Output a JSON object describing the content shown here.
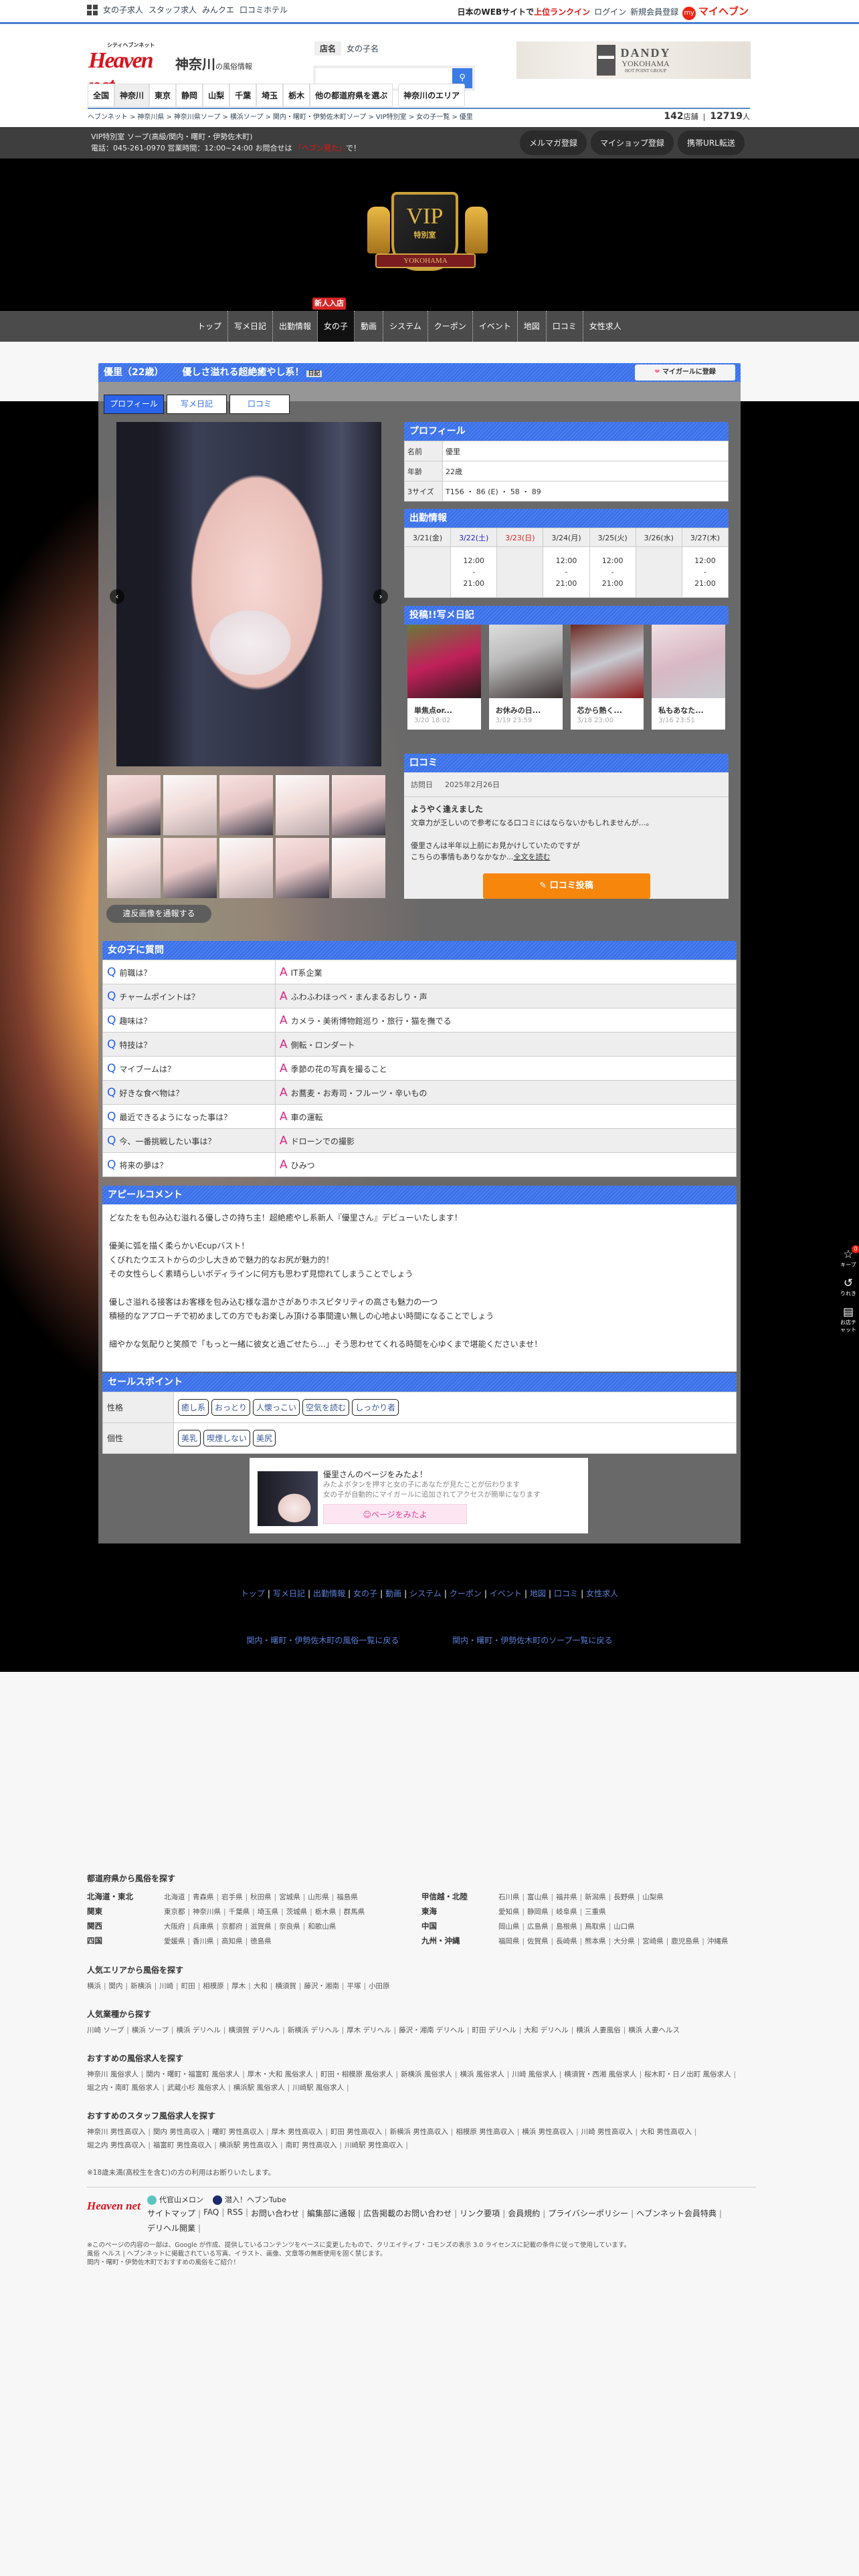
{
  "top_links": [
    "女の子求人",
    "スタッフ求人",
    "みんクエ",
    "口コミホテル"
  ],
  "top_right": {
    "prefix": "日本のWEBサイトで",
    "highlight": "上位ランクイン",
    "login": "ログイン",
    "register": "新規会員登録",
    "my_badge": "my",
    "myheaven": "マイヘブン"
  },
  "logo": {
    "text": "Heaven net",
    "kana": "シティヘブンネット",
    "region": "神奈川",
    "suffix": "の風俗情報"
  },
  "search": {
    "tabs": [
      "店名",
      "女の子名"
    ],
    "placeholder": ""
  },
  "banner": {
    "brand": "DANDY",
    "city": "YOKOHAMA",
    "group": "HOT POINT GROUP"
  },
  "pref_tabs": [
    "全国",
    "神奈川",
    "東京",
    "静岡",
    "山梨",
    "千葉",
    "埼玉",
    "栃木",
    "他の都道府県を選ぶ"
  ],
  "area_tab": "神奈川のエリア",
  "breadcrumb": [
    "ヘブンネット >",
    "神奈川県 >",
    "神奈川県ソープ >",
    "横浜ソープ >",
    "関内・曙町・伊勢佐木町ソープ >",
    "VIP特別室 >",
    "女の子一覧 >",
    "優里"
  ],
  "counts": {
    "shops": "142",
    "shops_unit": "店舗",
    "people": "12719",
    "people_unit": "人"
  },
  "shop": {
    "line1": "VIP特別室 ソープ(高級/関内・曙町・伊勢佐木町)",
    "line2": "電話：045-261-0970 営業時間：12:00~24:00 お問合せは",
    "mention": "「ヘブン見た」",
    "tail": "で！",
    "buttons": [
      "メルマガ登録",
      "マイショップ登録",
      "携帯URL転送"
    ]
  },
  "hero_logo": {
    "vip": "VIP",
    "sub": "特別室",
    "city": "YOKOHAMA"
  },
  "nav": {
    "items": [
      "トップ",
      "写メ日記",
      "出勤情報",
      "女の子",
      "動画",
      "システム",
      "クーポン",
      "イベント",
      "地図",
      "口コミ",
      "女性求人"
    ],
    "active": 3,
    "badge": "新人入店"
  },
  "girl": {
    "name": "優里（22歳）",
    "catch": "優しさ溢れる超絶癒やし系！",
    "diary_badge": "日記",
    "mygirl": "マイガールに登録"
  },
  "profile_tabs": [
    "プロフィール",
    "写メ日記",
    "口コミ"
  ],
  "profile": {
    "title": "プロフィール",
    "rows": [
      {
        "k": "名前",
        "v": "優里"
      },
      {
        "k": "年齢",
        "v": "22歳"
      },
      {
        "k": "3サイズ",
        "v": "T156 ・ 86 (E) ・ 58 ・ 89"
      }
    ]
  },
  "schedule": {
    "title": "出勤情報",
    "days": [
      {
        "d": "3/21(金)",
        "t": "",
        "c": "#333"
      },
      {
        "d": "3/22(土)",
        "t": "12:00\n-\n21:00",
        "c": "#2222cc"
      },
      {
        "d": "3/23(日)",
        "t": "",
        "c": "#e02020"
      },
      {
        "d": "3/24(月)",
        "t": "12:00\n-\n21:00",
        "c": "#333"
      },
      {
        "d": "3/25(火)",
        "t": "12:00\n-\n21:00",
        "c": "#333"
      },
      {
        "d": "3/26(水)",
        "t": "",
        "c": "#333"
      },
      {
        "d": "3/27(木)",
        "t": "12:00\n-\n21:00",
        "c": "#333"
      }
    ]
  },
  "diary": {
    "title": "投稿!!写メ日記",
    "items": [
      {
        "title": "単焦点or...",
        "date": "3/20 18:02"
      },
      {
        "title": "お休みの日...",
        "date": "3/19 23:59"
      },
      {
        "title": "芯から熱く...",
        "date": "3/18 23:00"
      },
      {
        "title": "私もあなた...",
        "date": "3/16 23:51"
      }
    ]
  },
  "review": {
    "title": "口コミ",
    "visit_label": "訪問日",
    "visit_date": "2025年2月26日",
    "headline": "ようやく逢えました",
    "line1": "文章力が乏しいので参考になる口コミにはならないかもしれませんが…。",
    "line2": "優里さんは半年以上前にお見かけしていたのですが",
    "line3": "こちらの事情もありなかなか...",
    "more": "全文を読む",
    "post": "✎ 口コミ投稿"
  },
  "report_label": "違反画像を通報する",
  "qa": {
    "title": "女の子に質問",
    "q_mark": "Q",
    "a_mark": "A",
    "items": [
      {
        "q": "前職は？",
        "a": "IT系企業"
      },
      {
        "q": "チャームポイントは？",
        "a": "ふわふわほっぺ・まんまるおしり・声"
      },
      {
        "q": "趣味は？",
        "a": "カメラ・美術博物館巡り・旅行・猫を撫でる"
      },
      {
        "q": "特技は？",
        "a": "側転・ロンダート"
      },
      {
        "q": "マイブームは？",
        "a": "季節の花の写真を撮ること"
      },
      {
        "q": "好きな食べ物は？",
        "a": "お蕎麦・お寿司・フルーツ・辛いもの"
      },
      {
        "q": "最近できるようになった事は？",
        "a": "車の運転"
      },
      {
        "q": "今、一番挑戦したい事は？",
        "a": "ドローンでの撮影"
      },
      {
        "q": "将来の夢は？",
        "a": "ひみつ"
      }
    ]
  },
  "appeal": {
    "title": "アピールコメント",
    "paragraphs": [
      [
        "どなたをも包み込む溢れる優しさの持ち主！超絶癒やし系新人『優里さん』デビューいたします！"
      ],
      [
        "優美に弧を描く柔らかいEcupバスト！",
        "くびれたウエストからの少し大きめで魅力的なお尻が魅力的！",
        "その女性らしく素晴らしいボディラインに何方も思わず見惚れてしまうことでしょう"
      ],
      [
        "優しさ溢れる接客はお客様を包み込む様な温かさがありホスピタリティの高さも魅力の一つ",
        "積極的なアプローチで初めましての方でもお楽しみ頂ける事間違い無しの心地よい時間になることでしょう"
      ],
      [
        "細やかな気配りと笑顔で「もっと一緒に彼女と過ごせたら…」そう思わせてくれる時間を心ゆくまで堪能くださいませ！"
      ]
    ]
  },
  "sales": {
    "title": "セールスポイント",
    "rows": [
      {
        "k": "性格",
        "tags": [
          "癒し系",
          "おっとり",
          "人懐っこい",
          "空気を読む",
          "しっかり者"
        ]
      },
      {
        "k": "個性",
        "tags": [
          "美乳",
          "喫煙しない",
          "美尻"
        ]
      }
    ]
  },
  "mitayo": {
    "title": "優里さんのページをみたよ！",
    "desc1": "みたよボタンを押すと女の子にあなたが見たことが伝わります",
    "desc2": "女の子が自動的にマイガールに追加されてアクセスが簡単になります",
    "button": "☺ページをみたよ"
  },
  "footer_nav": [
    "トップ",
    "写メ日記",
    "出勤情報",
    "女の子",
    "動画",
    "システム",
    "クーポン",
    "イベント",
    "地図",
    "口コミ",
    "女性求人"
  ],
  "back_links": [
    "関内・曙町・伊勢佐木町の風俗一覧に戻る",
    "関内・曙町・伊勢佐木町のソープ一覧に戻る"
  ],
  "footer": {
    "pref_title": "都道府県から風俗を探す",
    "regions_left": [
      {
        "name": "北海道・東北",
        "prefs": [
          "北海道",
          "青森県",
          "岩手県",
          "秋田県",
          "宮城県",
          "山形県",
          "福島県"
        ]
      },
      {
        "name": "関東",
        "prefs": [
          "東京都",
          "神奈川県",
          "千葉県",
          "埼玉県",
          "茨城県",
          "栃木県",
          "群馬県"
        ]
      },
      {
        "name": "関西",
        "prefs": [
          "大阪府",
          "兵庫県",
          "京都府",
          "滋賀県",
          "奈良県",
          "和歌山県"
        ]
      },
      {
        "name": "四国",
        "prefs": [
          "愛媛県",
          "香川県",
          "高知県",
          "徳島県"
        ]
      }
    ],
    "regions_right": [
      {
        "name": "甲信越・北陸",
        "prefs": [
          "石川県",
          "富山県",
          "福井県",
          "新潟県",
          "長野県",
          "山梨県"
        ]
      },
      {
        "name": "東海",
        "prefs": [
          "愛知県",
          "静岡県",
          "岐阜県",
          "三重県"
        ]
      },
      {
        "name": "中国",
        "prefs": [
          "岡山県",
          "広島県",
          "島根県",
          "鳥取県",
          "山口県"
        ]
      },
      {
        "name": "九州・沖縄",
        "prefs": [
          "福岡県",
          "佐賀県",
          "長崎県",
          "熊本県",
          "大分県",
          "宮崎県",
          "鹿児島県",
          "沖縄県"
        ]
      }
    ],
    "area_title": "人気エリアから風俗を探す",
    "areas": [
      "横浜",
      "関内",
      "新横浜",
      "川崎",
      "町田",
      "相模原",
      "厚木",
      "大和",
      "横須賀",
      "藤沢・湘南",
      "平塚",
      "小田原"
    ],
    "genre_title": "人気業種から探す",
    "genres": [
      "川崎 ソープ",
      "横浜 ソープ",
      "横浜 デリヘル",
      "横須賀 デリヘル",
      "新横浜 デリヘル",
      "厚木 デリヘル",
      "藤沢・湘南 デリヘル",
      "町田 デリヘル",
      "大和 デリヘル",
      "横浜 人妻風俗",
      "横浜 人妻ヘルス"
    ],
    "jobs_title": "おすすめの風俗求人を探す",
    "jobs": [
      "神奈川 風俗求人",
      "関内・曙町・福富町 風俗求人",
      "厚木・大和 風俗求人",
      "町田・相模原 風俗求人",
      "新横浜 風俗求人",
      "横浜 風俗求人",
      "川崎 風俗求人",
      "横須賀・西湘 風俗求人",
      "桜木町・日ノ出町 風俗求人",
      "堀之内・南町 風俗求人",
      "武蔵小杉 風俗求人",
      "横浜駅 風俗求人",
      "川崎駅 風俗求人"
    ],
    "staff_title": "おすすめのスタッフ風俗求人を探す",
    "staff": [
      "神奈川 男性高収入",
      "関内 男性高収入",
      "曙町 男性高収入",
      "厚木 男性高収入",
      "町田 男性高収入",
      "新横浜 男性高収入",
      "相模原 男性高収入",
      "横浜 男性高収入",
      "川崎 男性高収入",
      "大和 男性高収入",
      "堀之内 男性高収入",
      "福富町 男性高収入",
      "横浜駅 男性高収入",
      "南町 男性高収入",
      "川崎駅 男性高収入"
    ],
    "notice": "※18歳未満(高校生を含む)の方の利用はお断りいたします。",
    "logo_text": "Heaven net",
    "partners": [
      "代官山メロン",
      "潜入！ヘブンTube"
    ],
    "links": [
      "サイトマップ",
      "FAQ",
      "RSS",
      "お問い合わせ",
      "編集部に通報",
      "広告掲載のお問い合わせ",
      "リンク要項",
      "会員規約",
      "プライバシーポリシー",
      "ヘブンネット会員特典",
      "デリヘル開業"
    ],
    "copy1": "※このページの内容の一部は、Google が作成、提供しているコンテンツをベースに変更したもので、クリエイティブ・コモンズの表示 3.0 ライセンスに記載の条件に従って使用しています。",
    "copy2": "風俗 ヘルス | ヘブンネットに掲載されている写真、イラスト、画像、文章等の無断使用を固く禁じます。",
    "copy3": "関内・曙町・伊勢佐木町でおすすめの風俗をご紹介！"
  },
  "side": {
    "keep": "キープ",
    "keep_count": "0",
    "history": "りれき",
    "chat": "お店チャット"
  }
}
